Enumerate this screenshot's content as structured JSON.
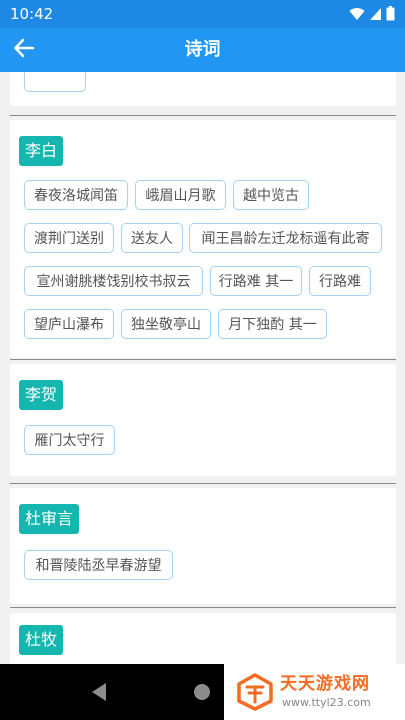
{
  "status_bar": {
    "time": "10:42"
  },
  "app_bar": {
    "title": "诗词",
    "back_icon": "arrow-left-icon"
  },
  "sections": [
    {
      "author": "李白",
      "poems": [
        "春夜洛城闻笛",
        "峨眉山月歌",
        "越中览古",
        "渡荆门送别",
        "送友人",
        "闻王昌龄左迁龙标遥有此寄",
        "宣州谢朓楼饯别校书叔云",
        "行路难 其一",
        "行路难",
        "望庐山瀑布",
        "独坐敬亭山",
        "月下独酌 其一"
      ]
    },
    {
      "author": "李贺",
      "poems": [
        "雁门太守行"
      ]
    },
    {
      "author": "杜审言",
      "poems": [
        "和晋陵陆丞早春游望"
      ]
    },
    {
      "author": "杜牧",
      "poems": []
    }
  ],
  "watermark": {
    "name": "天天游戏网",
    "url": "www.ttyl23.com"
  },
  "colors": {
    "status_bar": "#1e88e5",
    "app_bar": "#2196f3",
    "author_tag": "#15b5b0",
    "poem_border": "#a7d1f3",
    "background": "#f1f1f1"
  }
}
